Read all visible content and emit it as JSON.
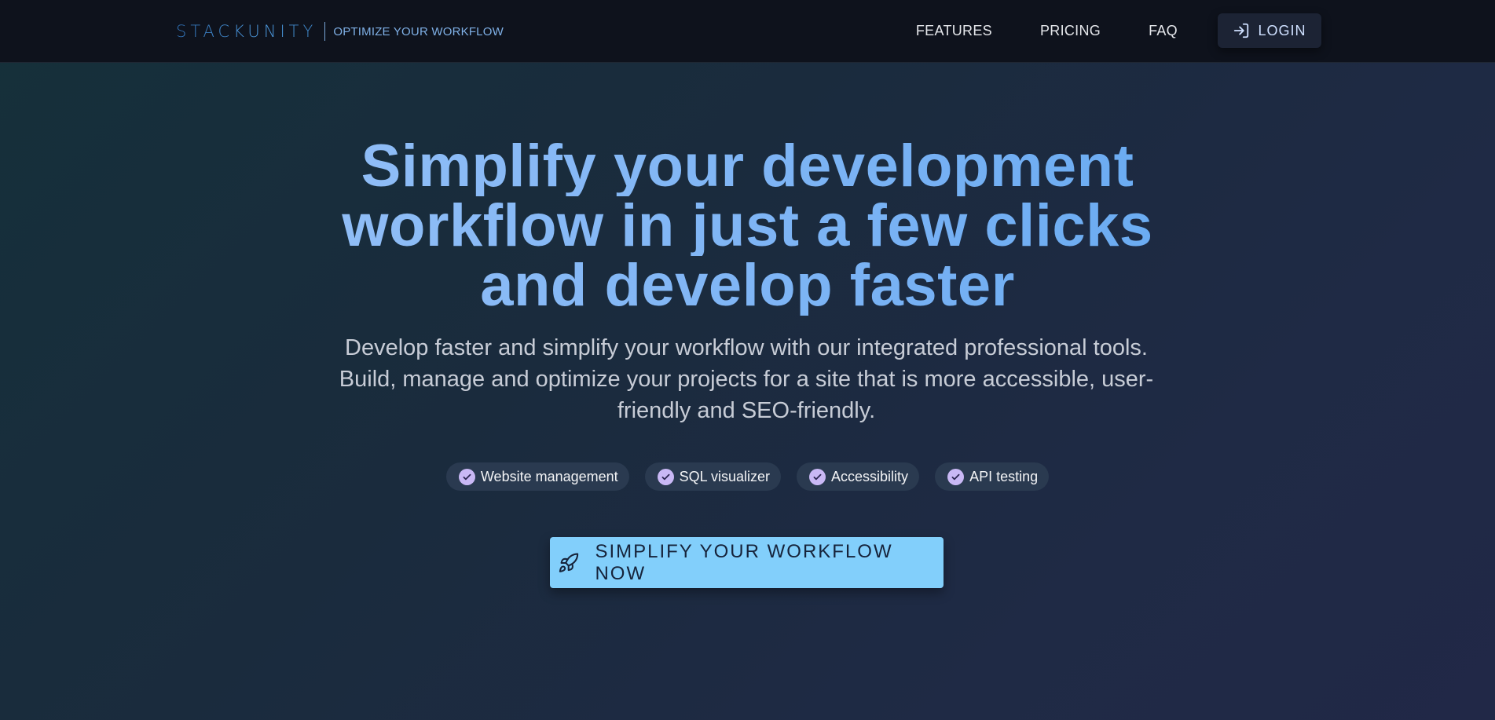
{
  "header": {
    "logo_text": "STACKUNITY",
    "tagline": "OPTIMIZE YOUR WORKFLOW",
    "nav": [
      {
        "label": "FEATURES"
      },
      {
        "label": "PRICING"
      },
      {
        "label": "FAQ"
      }
    ],
    "login_label": "LOGIN",
    "login_icon": "login-icon"
  },
  "hero": {
    "title_lines": [
      "Simplify your development",
      "workflow in just a few clicks",
      "and develop faster"
    ],
    "subtitle": "Develop faster and simplify your workflow with our integrated professional tools. Build, manage and optimize your projects for a site that is more accessible, user-friendly and SEO-friendly.",
    "features": [
      {
        "label": "Website management",
        "icon": "check-circle-icon"
      },
      {
        "label": "SQL visualizer",
        "icon": "check-circle-icon"
      },
      {
        "label": "Accessibility",
        "icon": "check-circle-icon"
      },
      {
        "label": "API testing",
        "icon": "check-circle-icon"
      }
    ],
    "cta_label": "SIMPLIFY YOUR WORKFLOW NOW",
    "cta_icon": "rocket-icon"
  },
  "colors": {
    "header_bg": "#0e121c",
    "accent_blue": "#82cffb",
    "title_gradient_start": "#9dc4f7",
    "title_gradient_end": "#5aa3ef",
    "check_purple": "#c9b8f5"
  }
}
